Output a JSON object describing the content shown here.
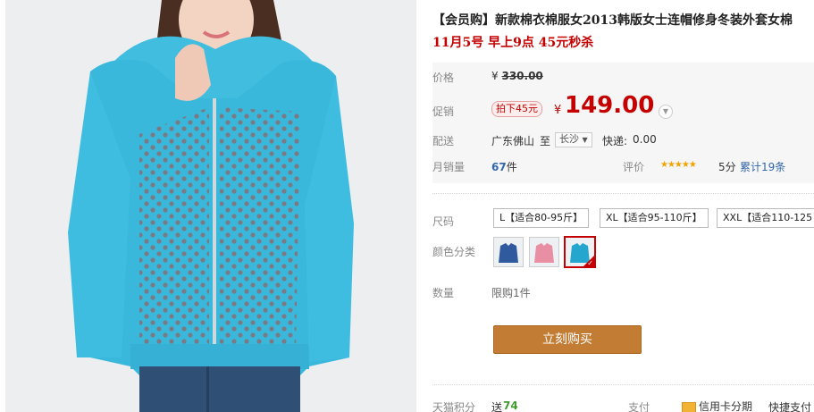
{
  "product": {
    "title": "【会员购】新款棉衣棉服女2013韩版女士连帽修身冬装外套女棉",
    "promo_text": "11月5号 早上9点 45元秒杀"
  },
  "price": {
    "label": "价格",
    "currency": "¥",
    "original": "330.00"
  },
  "promotion": {
    "label": "促销",
    "tag": "拍下45元",
    "currency": "¥",
    "value": "149.00",
    "expand_icon": "chevron-down-icon"
  },
  "shipping": {
    "label": "配送",
    "from": "广东佛山",
    "to_word": "至",
    "destination": "长沙",
    "express_label": "快递:",
    "express_fee": "0.00"
  },
  "sales": {
    "label": "月销量",
    "count": "67",
    "unit": "件",
    "rating_label": "评价",
    "stars": "★★★★★",
    "score": "5分",
    "total_reviews": "累计19条"
  },
  "size": {
    "label": "尺码",
    "options": [
      "L【适合80-95斤】",
      "XL【适合95-110斤】",
      "XXL【适合110-125"
    ]
  },
  "color": {
    "label": "颜色分类",
    "swatches": [
      {
        "name": "navy",
        "color": "#2f5a9e"
      },
      {
        "name": "pink",
        "color": "#e98fa3"
      },
      {
        "name": "sky-blue",
        "color": "#25a6cf",
        "selected": true
      }
    ]
  },
  "quantity": {
    "label": "数量",
    "limit": "限购1件"
  },
  "buy_button": "立刻购买",
  "footer": {
    "points_label": "天猫积分",
    "points_give": "送",
    "points_value": "74",
    "pay_label": "支付",
    "installment": "信用卡分期",
    "quick_pay": "快捷支付"
  },
  "colors": {
    "accent_red": "#c40000",
    "buy_button": "#c27c34",
    "link_blue": "#3366aa",
    "jacket": "#3ab8dc"
  }
}
